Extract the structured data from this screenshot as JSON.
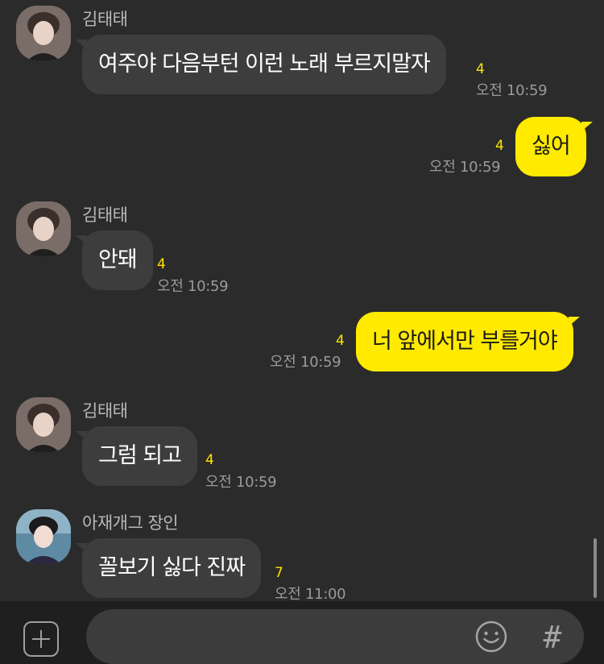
{
  "messages": [
    {
      "sender": "김태태",
      "text": "여주야 다음부턴 이런 노래 부르지말자",
      "unread": "4",
      "time": "오전 10:59"
    },
    {
      "text": "싫어",
      "unread": "4",
      "time": "오전 10:59"
    },
    {
      "sender": "김태태",
      "text": "안돼",
      "unread": "4",
      "time": "오전 10:59"
    },
    {
      "text": "너 앞에서만 부를거야",
      "unread": "4",
      "time": "오전 10:59"
    },
    {
      "sender": "김태태",
      "text": "그럼 되고",
      "unread": "4",
      "time": "오전 10:59"
    },
    {
      "sender": "아재개그 장인",
      "text": "꼴보기 싫다 진짜",
      "unread": "7",
      "time": "오전 11:00"
    }
  ],
  "input": {
    "hash_label": "#"
  },
  "colors": {
    "background": "#2b2b2b",
    "incoming_bubble": "#3d3d3d",
    "outgoing_bubble": "#ffea00",
    "unread": "#ffe400"
  }
}
